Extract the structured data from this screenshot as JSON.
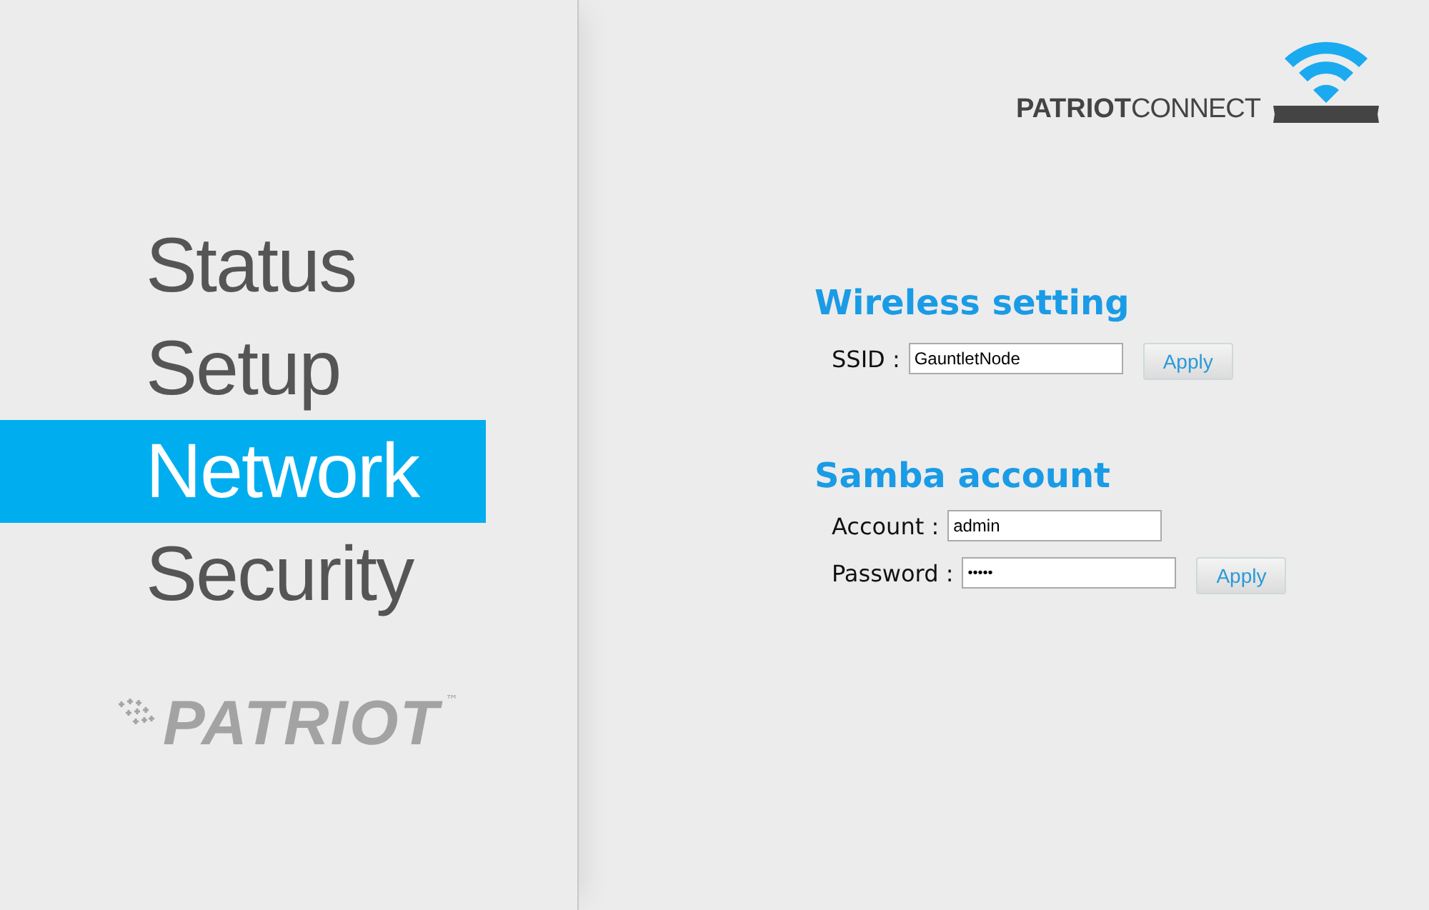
{
  "menu": [
    {
      "label": "Status",
      "selected": false
    },
    {
      "label": "Setup",
      "selected": false
    },
    {
      "label": "Network",
      "selected": true
    },
    {
      "label": "Security",
      "selected": false
    }
  ],
  "sidebar_logo": {
    "name": "PATRIOT",
    "mark": "™"
  },
  "header_logo": {
    "bold": "PATRIOT",
    "light": "CONNECT"
  },
  "sections": [
    {
      "title": "Wireless setting",
      "fields": [
        {
          "label": "SSID :",
          "value": "GauntletNode",
          "kind": "text"
        }
      ],
      "button": "Apply"
    },
    {
      "title": "Samba account",
      "fields": [
        {
          "label": "Account :",
          "value": "admin",
          "kind": "text"
        },
        {
          "label": "Password :",
          "value": "•••••",
          "kind": "password"
        }
      ],
      "button": "Apply"
    }
  ]
}
